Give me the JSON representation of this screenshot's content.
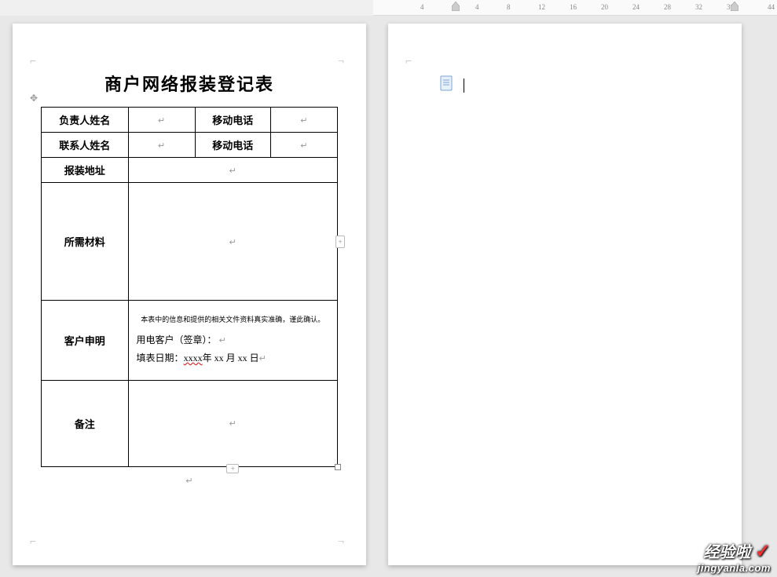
{
  "ruler": {
    "ticks": [
      "4",
      "4",
      "8",
      "12",
      "16",
      "20",
      "24",
      "28",
      "32",
      "36",
      "44"
    ]
  },
  "document": {
    "title": "商户网络报装登记表",
    "rows": {
      "r1": {
        "label1": "负责人姓名",
        "label2": "移动电话"
      },
      "r2": {
        "label1": "联系人姓名",
        "label2": "移动电话"
      },
      "r3": {
        "label": "报装地址"
      },
      "r4": {
        "label": "所需材料"
      },
      "r5": {
        "label": "客户申明",
        "notice": "本表中的信息和提供的相关文件资料真实准确，谨此确认。",
        "line2_prefix": "用电客户（签章）：",
        "line3_prefix": "填表日期：",
        "date_year": "xxxx",
        "date_y": "年 ",
        "date_month": "xx",
        "date_m": " 月 ",
        "date_day": "xx",
        "date_d": " 日"
      },
      "r6": {
        "label": "备注"
      }
    },
    "para_mark": "↵"
  },
  "watermark": {
    "top": "经验啦",
    "check": "✓",
    "bottom": "jingyanla.com"
  }
}
